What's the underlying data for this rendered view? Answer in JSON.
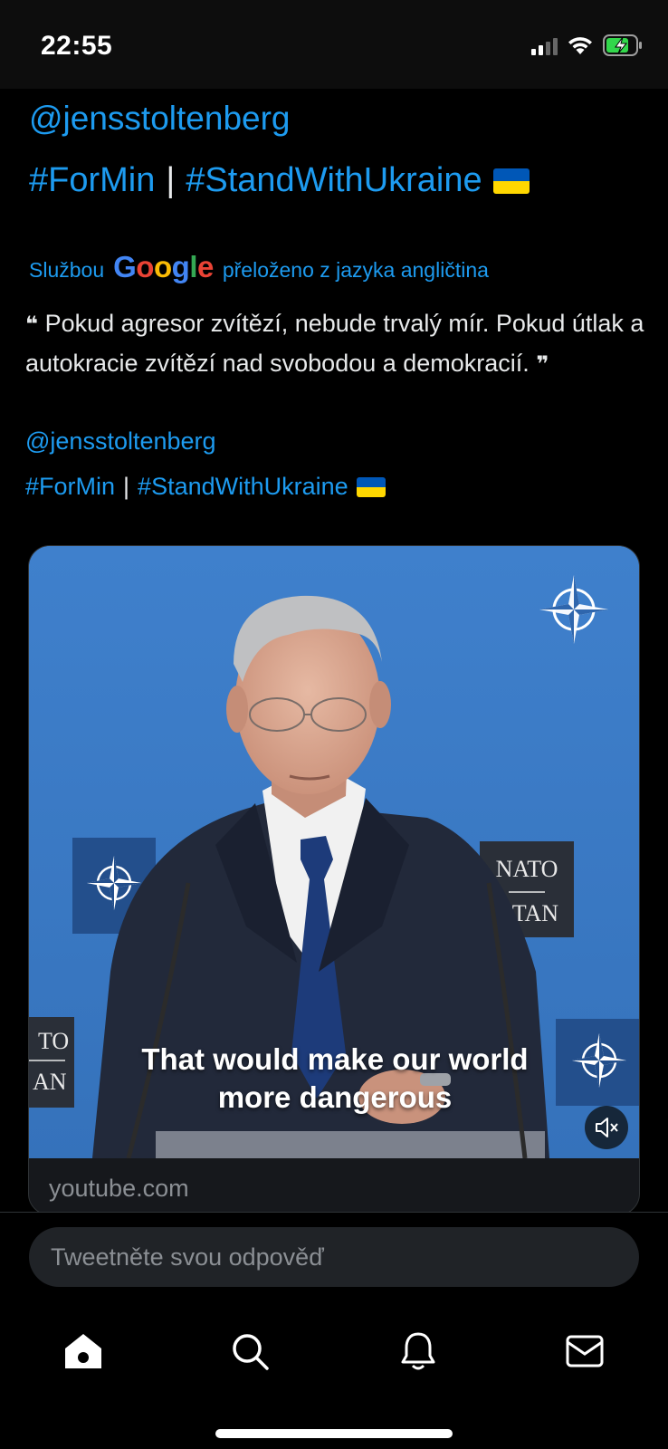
{
  "status_bar": {
    "time": "22:55"
  },
  "tweet": {
    "original_handle": "@jensstoltenberg",
    "original_tag_1": "#ForMin",
    "original_separator": "|",
    "original_tag_2": "#StandWithUkraine",
    "translated_by_prefix": "Službou",
    "translated_by_suffix": "přeloženo z jazyka angličtina",
    "translation_text": "Pokud agresor zvítězí, nebude trvalý mír. Pokud útlak a autokracie zvítězí nad svobodou a demokracií.",
    "translated_handle": "@jensstoltenberg",
    "translated_tag_1": "#ForMin",
    "translated_separator": "|",
    "translated_tag_2": "#StandWithUkraine",
    "flag_emoji": "ukraine-flag"
  },
  "media": {
    "caption_line_1": "That would make our world",
    "caption_line_2": "more dangerous",
    "nato_sign_right_1": "NATO",
    "nato_sign_right_2": "OTAN",
    "nato_sign_left_1": "TO",
    "nato_sign_left_2": "AN",
    "card_domain": "youtube.com",
    "muted": true
  },
  "reply": {
    "placeholder": "Tweetněte svou odpověď"
  },
  "tab_bar": {
    "items": [
      {
        "icon": "home-icon",
        "active": true
      },
      {
        "icon": "search-icon",
        "active": false
      },
      {
        "icon": "bell-icon",
        "active": false
      },
      {
        "icon": "mail-icon",
        "active": false
      }
    ]
  },
  "colors": {
    "link": "#1d9bf0",
    "background": "#000000",
    "text": "#e7e9ea",
    "video_background": "#3b79c3"
  }
}
